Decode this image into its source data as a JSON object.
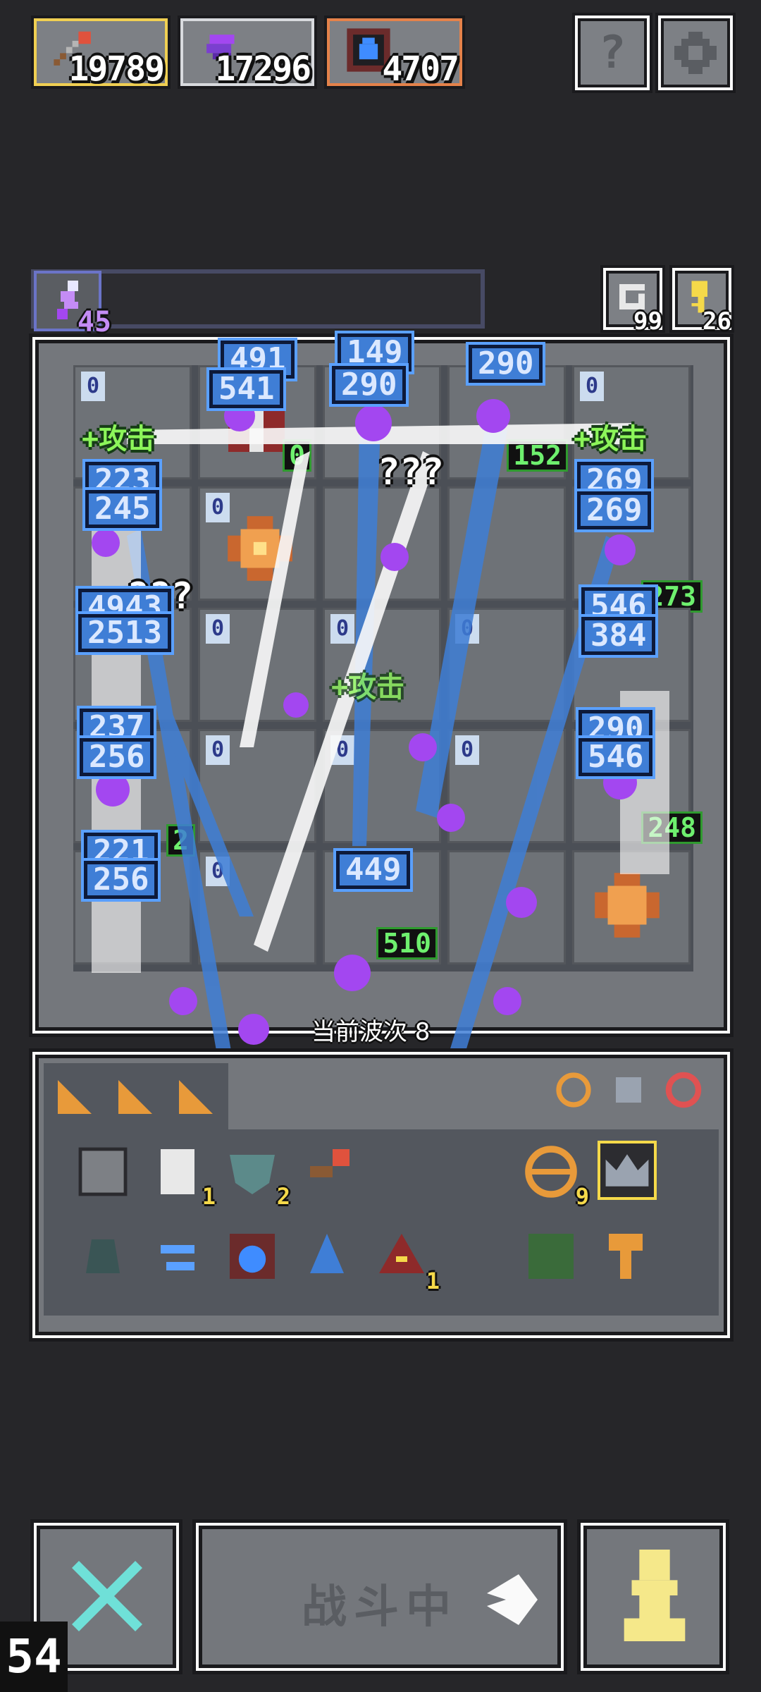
{
  "resources": [
    {
      "name": "arrow",
      "value": "19789"
    },
    {
      "name": "feather",
      "value": "17296"
    },
    {
      "name": "water-orb",
      "value": "4707"
    }
  ],
  "top_buttons": {
    "help_symbol": "?"
  },
  "energy": {
    "count": "45"
  },
  "counters": {
    "recycle": "99",
    "key": "26"
  },
  "board": {
    "tags": [
      "0",
      "0",
      "0",
      "0",
      "0",
      "0",
      "0",
      "0",
      "0",
      "0",
      "0",
      "0"
    ],
    "levels": [
      "0",
      "152",
      "273",
      "248",
      "510",
      "2"
    ],
    "attack_label": "+攻击",
    "damage": [
      "491",
      "541",
      "149",
      "290",
      "290",
      "269",
      "223",
      "245",
      "269",
      "290",
      "4943",
      "2513",
      "546",
      "384",
      "237",
      "256",
      "290",
      "546",
      "221",
      "256",
      "449"
    ],
    "unknown": "???",
    "wave_text": "当前波次 8"
  },
  "inventory": {
    "counts": [
      "1",
      "2",
      "9",
      "1"
    ]
  },
  "bottom": {
    "fight_label": "战斗中"
  },
  "fps": "54",
  "colors": {
    "bg": "#262629",
    "frame": "#fafafa",
    "panel": "#74777c",
    "damage_bg": "#3f7ed6",
    "level_green": "#6ef06e",
    "purple": "#a347f0"
  }
}
